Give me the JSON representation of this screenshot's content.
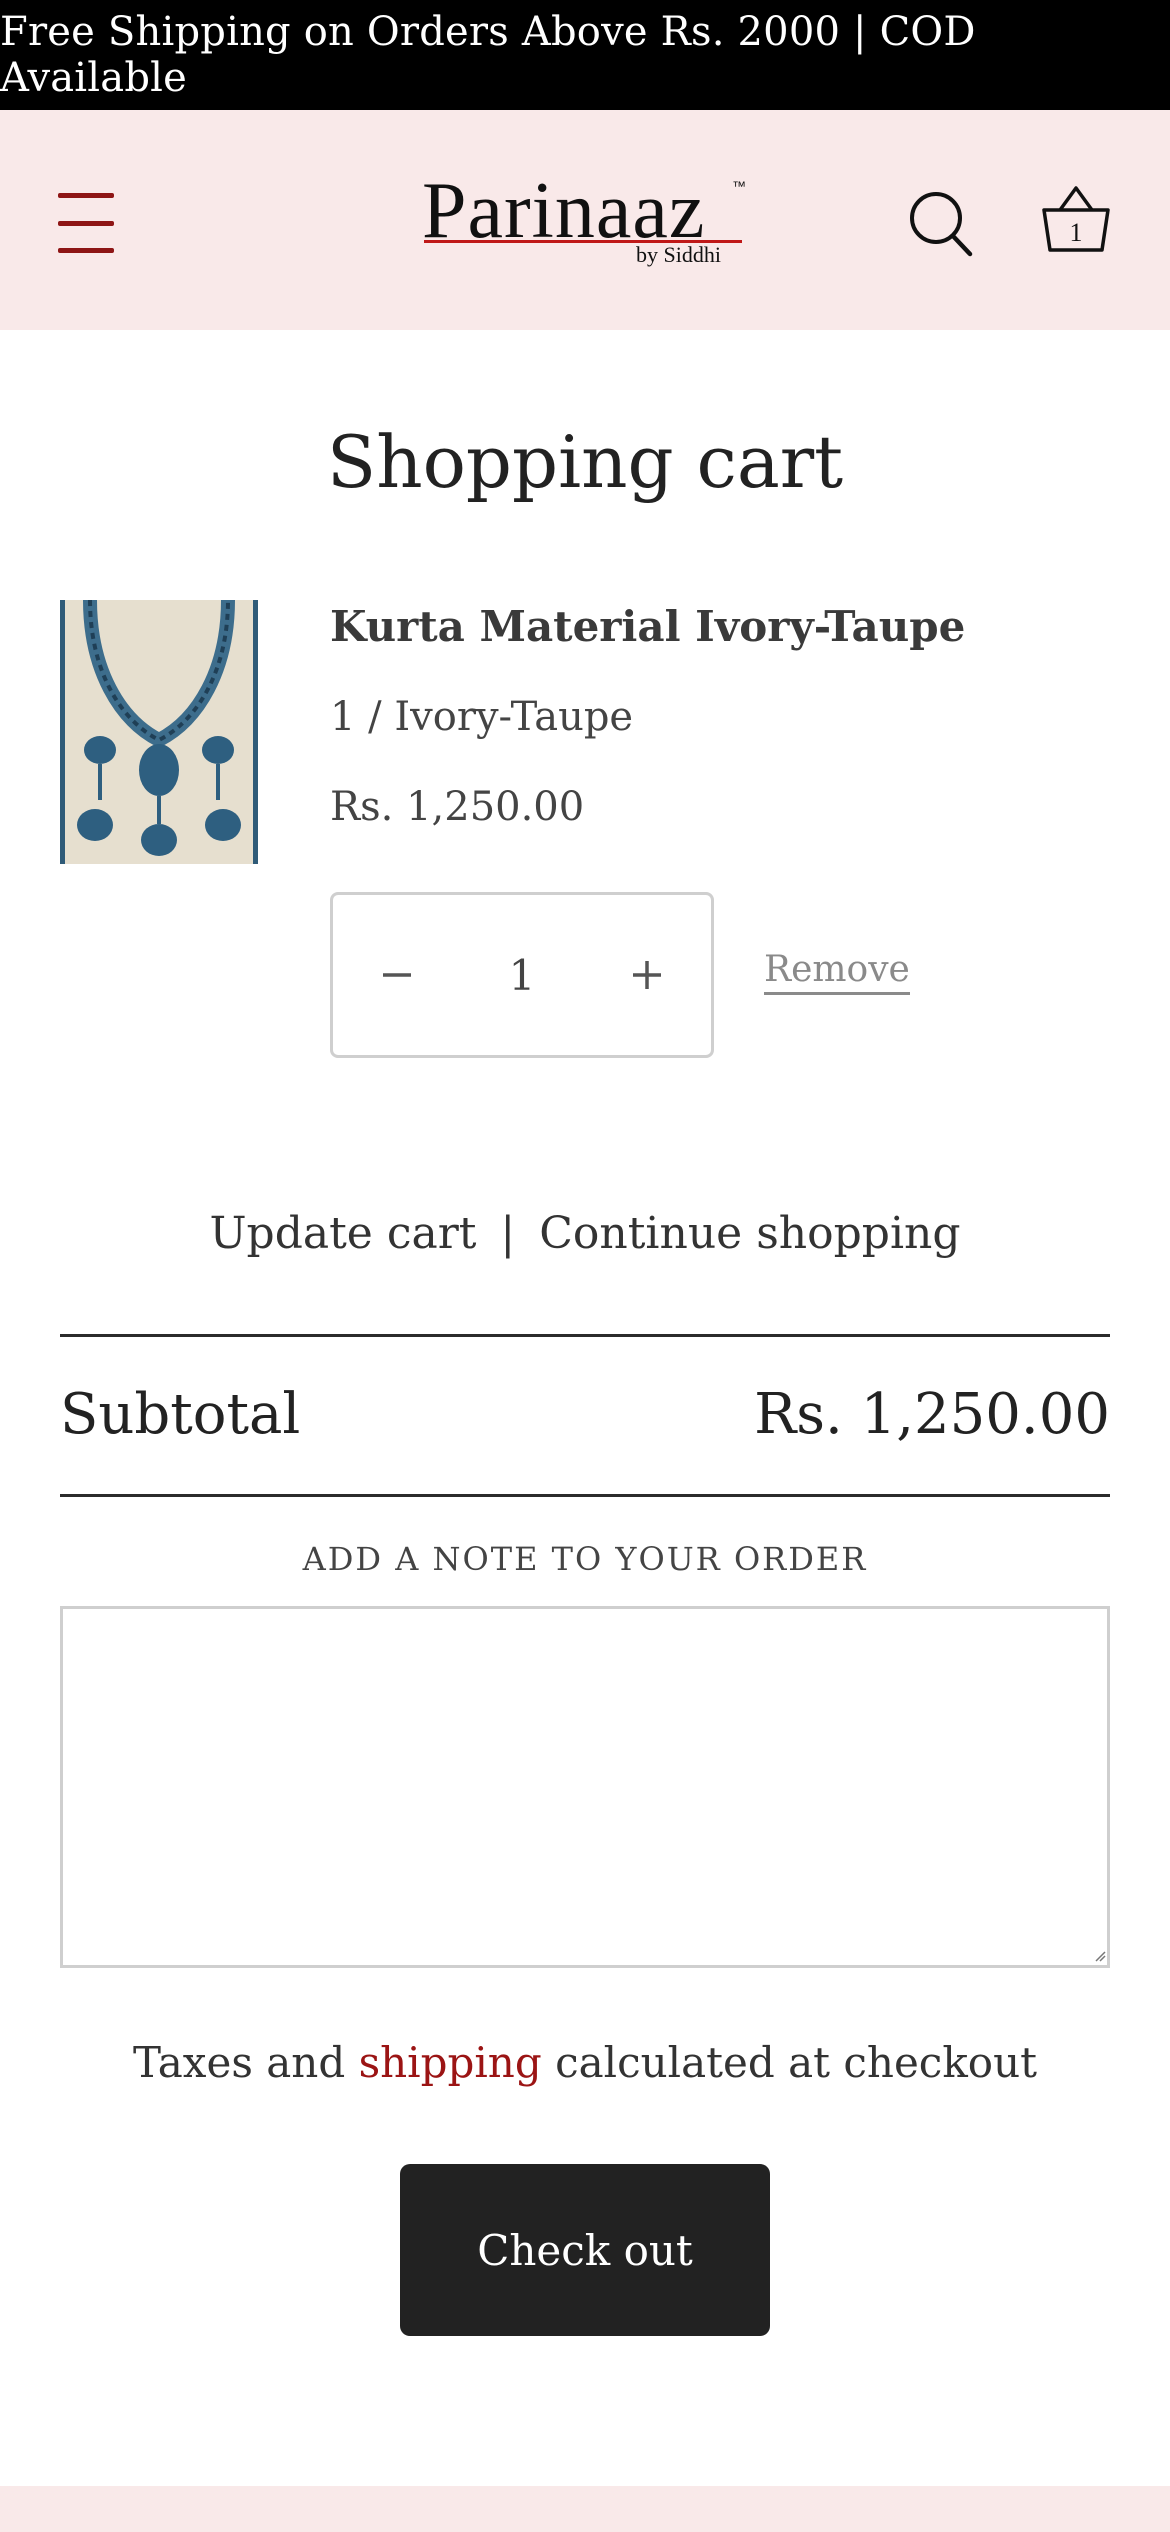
{
  "announcement": {
    "text": "Free Shipping on Orders Above Rs. 2000 | COD Available"
  },
  "header": {
    "menu_icon": "hamburger-menu-icon",
    "logo": {
      "name": "Parinaaz",
      "tm": "™",
      "sub": "by Siddhi"
    },
    "search_icon": "search-icon",
    "cart_icon": "basket-icon",
    "cart_count": "1"
  },
  "colors": {
    "announcement_bg": "#000000",
    "header_bg": "#f9e9e9",
    "accent": "#8e1515",
    "link_red": "#9b1414",
    "checkout_bg": "#222222"
  },
  "cart": {
    "title": "Shopping cart",
    "items": [
      {
        "title": "Kurta Material Ivory-Taupe",
        "variant": "1 / Ivory-Taupe",
        "price": "Rs. 1,250.00",
        "quantity": "1",
        "minus_icon": "minus-icon",
        "plus_icon": "plus-icon",
        "remove_label": "Remove"
      }
    ],
    "update_label": "Update cart",
    "separator": "|",
    "continue_label": "Continue shopping",
    "subtotal_label": "Subtotal",
    "subtotal_value": "Rs. 1,250.00",
    "note_label": "ADD A NOTE TO YOUR ORDER",
    "note_value": "",
    "taxes_before": "Taxes and ",
    "taxes_link": "shipping",
    "taxes_after": " calculated at checkout",
    "checkout_label": "Check out"
  }
}
